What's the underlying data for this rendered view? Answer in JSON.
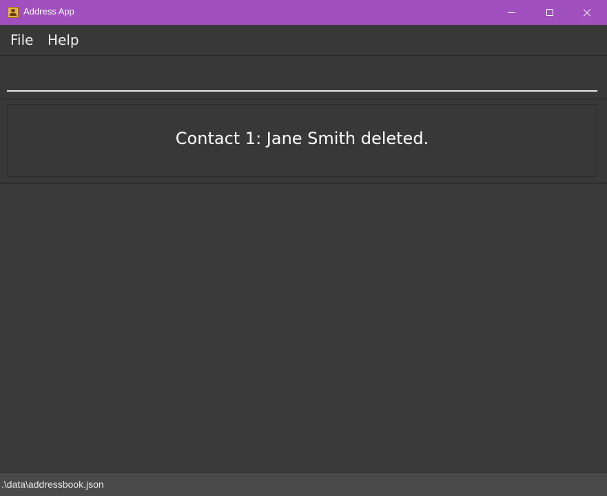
{
  "window": {
    "title": "Address App",
    "icon": "address-book-icon",
    "controls": {
      "minimize": "minimize-icon",
      "maximize": "maximize-icon",
      "close": "close-icon"
    }
  },
  "menu": {
    "items": [
      {
        "label": "File"
      },
      {
        "label": "Help"
      }
    ]
  },
  "command_box": {
    "value": "",
    "placeholder": ""
  },
  "result_display": {
    "message": "Contact 1: Jane Smith deleted."
  },
  "contact_list": {
    "items": []
  },
  "status_bar": {
    "save_location": ".\\data\\addressbook.json"
  },
  "colors": {
    "titlebar": "#a050be",
    "background": "#383838",
    "status_bar": "#4a4a4a",
    "text": "#ffffff"
  }
}
